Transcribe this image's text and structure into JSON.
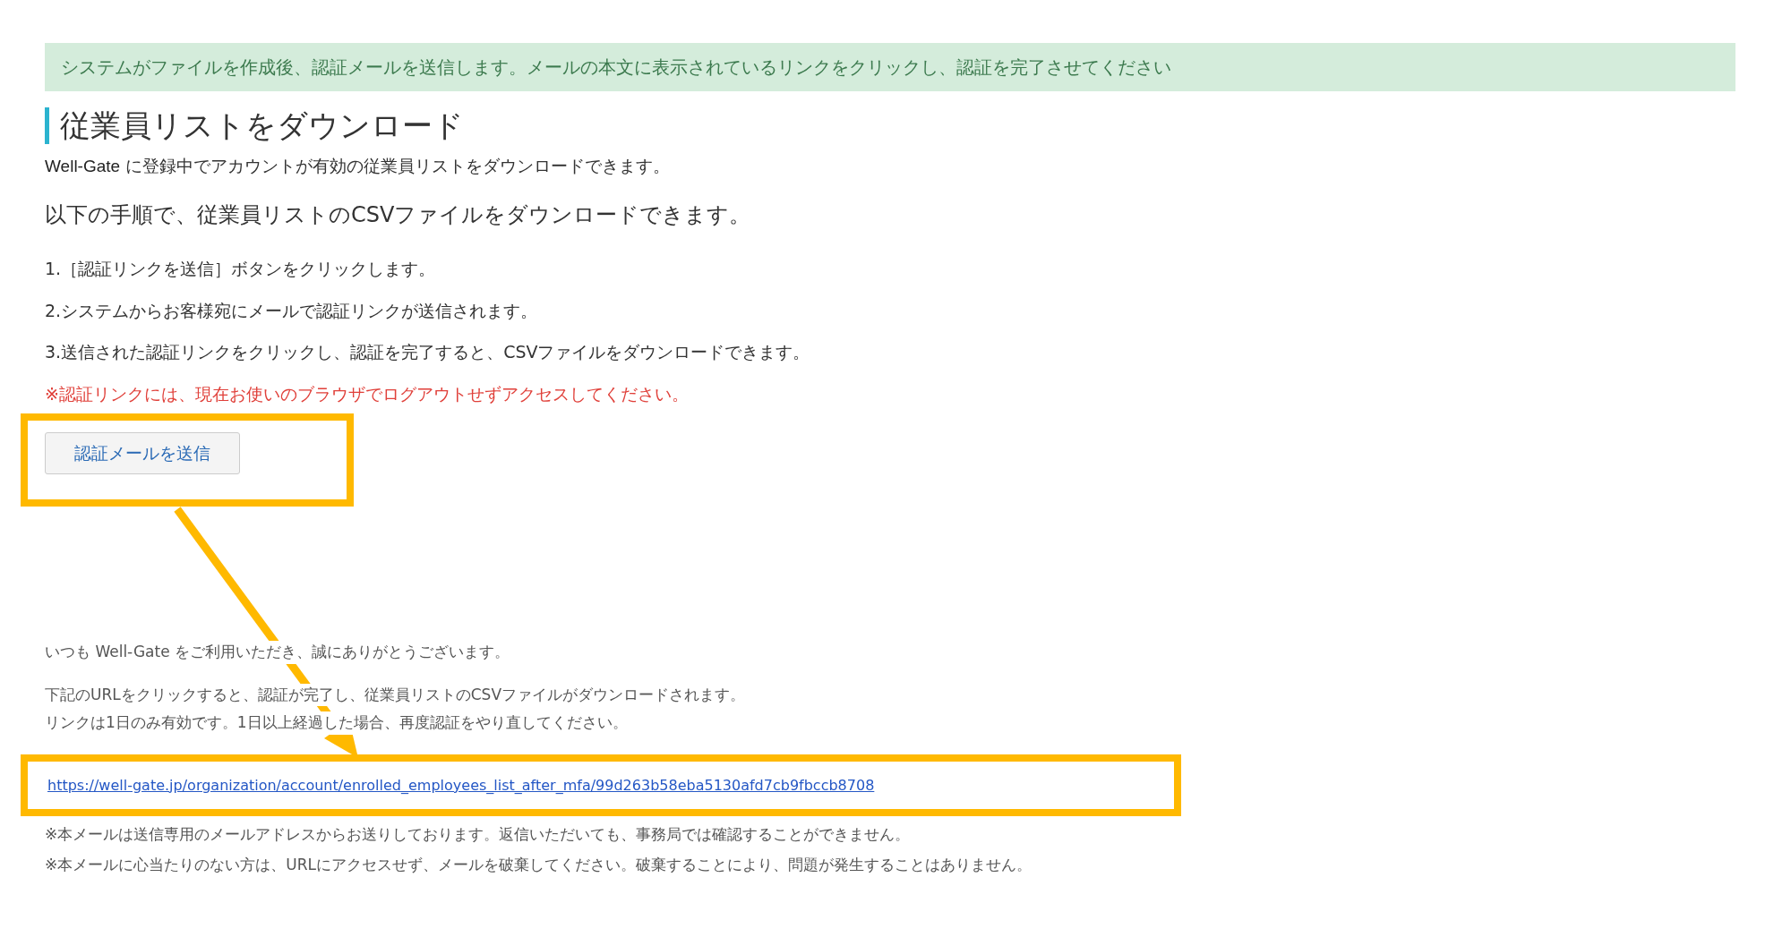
{
  "banner": "システムがファイルを作成後、認証メールを送信します。メールの本文に表示されているリンクをクリックし、認証を完了させてください",
  "title": "従業員リストをダウンロード",
  "intro": {
    "brand": "Well-Gate",
    "text": "に登録中でアカウントが有効の従業員リストをダウンロードできます。"
  },
  "lead": "以下の手順で、従業員リストのCSVファイルをダウンロードできます。",
  "steps": [
    "1.［認証リンクを送信］ボタンをクリックします。",
    "2.システムからお客様宛にメールで認証リンクが送信されます。",
    "3.送信された認証リンクをクリックし、認証を完了すると、CSVファイルをダウンロードできます。"
  ],
  "warning": "※認証リンクには、現在お使いのブラウザでログアウトせずアクセスしてください。",
  "send_button": "認証メールを送信",
  "email": {
    "greeting": "いつも Well-Gate をご利用いただき、誠にありがとうございます。",
    "body": [
      "下記のURLをクリックすると、認証が完了し、従業員リストのCSVファイルがダウンロードされます。",
      "リンクは1日のみ有効です。1日以上経過した場合、再度認証をやり直してください。"
    ],
    "link": "https://well-gate.jp/organization/account/enrolled_employees_list_after_mfa/99d263b58eba5130afd7cb9fbccb8708",
    "notes": [
      "※本メールは送信専用のメールアドレスからお送りしております。返信いただいても、事務局では確認することができません。",
      "※本メールに心当たりのない方は、URLにアクセスせず、メールを破棄してください。破棄することにより、問題が発生することはありません。"
    ]
  }
}
